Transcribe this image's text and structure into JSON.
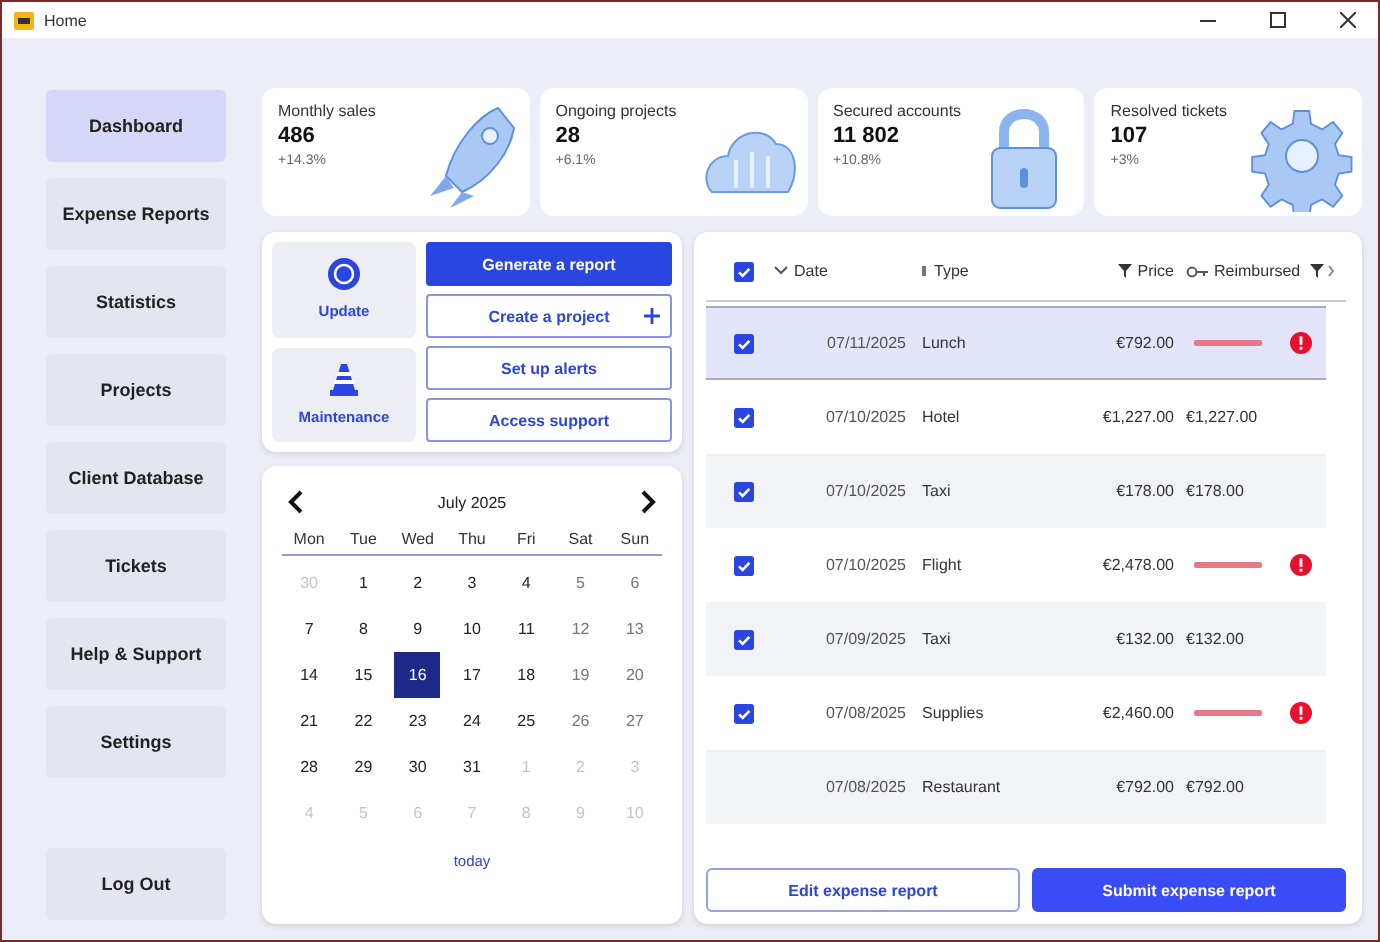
{
  "window": {
    "title": "Home"
  },
  "sidebar": {
    "items": [
      {
        "label": "Dashboard",
        "selected": true
      },
      {
        "label": "Expense Reports",
        "selected": false
      },
      {
        "label": "Statistics",
        "selected": false
      },
      {
        "label": "Projects",
        "selected": false
      },
      {
        "label": "Client Database",
        "selected": false
      },
      {
        "label": "Tickets",
        "selected": false
      },
      {
        "label": "Help & Support",
        "selected": false
      },
      {
        "label": "Settings",
        "selected": false
      }
    ],
    "logout": "Log Out"
  },
  "stats": [
    {
      "label": "Monthly sales",
      "value": "486",
      "change": "+14.3%"
    },
    {
      "label": "Ongoing projects",
      "value": "28",
      "change": "+6.1%"
    },
    {
      "label": "Secured accounts",
      "value": "11 802",
      "change": "+10.8%"
    },
    {
      "label": "Resolved tickets",
      "value": "107",
      "change": "+3%"
    }
  ],
  "quick_actions": {
    "tiles": [
      {
        "label": "Update"
      },
      {
        "label": "Maintenance"
      }
    ],
    "buttons": [
      {
        "label": "Generate a report",
        "kind": "primary"
      },
      {
        "label": "Create a project",
        "kind": "add"
      },
      {
        "label": "Set up alerts",
        "kind": "outline"
      },
      {
        "label": "Access support",
        "kind": "outline"
      }
    ]
  },
  "calendar": {
    "month": "July 2025",
    "weekdays": [
      "Mon",
      "Tue",
      "Wed",
      "Thu",
      "Fri",
      "Sat",
      "Sun"
    ],
    "days": [
      {
        "label": "30",
        "muted": true,
        "selected": false
      },
      {
        "label": "1",
        "muted": false,
        "selected": false
      },
      {
        "label": "2",
        "muted": false,
        "selected": false
      },
      {
        "label": "3",
        "muted": false,
        "selected": false
      },
      {
        "label": "4",
        "muted": false,
        "selected": false
      },
      {
        "label": "5",
        "muted": false,
        "selected": false
      },
      {
        "label": "6",
        "muted": false,
        "selected": false
      },
      {
        "label": "7",
        "muted": false,
        "selected": false
      },
      {
        "label": "8",
        "muted": false,
        "selected": false
      },
      {
        "label": "9",
        "muted": false,
        "selected": false
      },
      {
        "label": "10",
        "muted": false,
        "selected": false
      },
      {
        "label": "11",
        "muted": false,
        "selected": false
      },
      {
        "label": "12",
        "muted": false,
        "selected": false
      },
      {
        "label": "13",
        "muted": false,
        "selected": false
      },
      {
        "label": "14",
        "muted": false,
        "selected": false
      },
      {
        "label": "15",
        "muted": false,
        "selected": false
      },
      {
        "label": "16",
        "muted": false,
        "selected": true
      },
      {
        "label": "17",
        "muted": false,
        "selected": false
      },
      {
        "label": "18",
        "muted": false,
        "selected": false
      },
      {
        "label": "19",
        "muted": false,
        "selected": false
      },
      {
        "label": "20",
        "muted": false,
        "selected": false
      },
      {
        "label": "21",
        "muted": false,
        "selected": false
      },
      {
        "label": "22",
        "muted": false,
        "selected": false
      },
      {
        "label": "23",
        "muted": false,
        "selected": false
      },
      {
        "label": "24",
        "muted": false,
        "selected": false
      },
      {
        "label": "25",
        "muted": false,
        "selected": false
      },
      {
        "label": "26",
        "muted": false,
        "selected": false
      },
      {
        "label": "27",
        "muted": false,
        "selected": false
      },
      {
        "label": "28",
        "muted": false,
        "selected": false
      },
      {
        "label": "29",
        "muted": false,
        "selected": false
      },
      {
        "label": "30",
        "muted": false,
        "selected": false
      },
      {
        "label": "31",
        "muted": false,
        "selected": false
      },
      {
        "label": "1",
        "muted": true,
        "selected": false
      },
      {
        "label": "2",
        "muted": true,
        "selected": false
      },
      {
        "label": "3",
        "muted": true,
        "selected": false
      },
      {
        "label": "4",
        "muted": true,
        "selected": false
      },
      {
        "label": "5",
        "muted": true,
        "selected": false
      },
      {
        "label": "6",
        "muted": true,
        "selected": false
      },
      {
        "label": "7",
        "muted": true,
        "selected": false
      },
      {
        "label": "8",
        "muted": true,
        "selected": false
      },
      {
        "label": "9",
        "muted": true,
        "selected": false
      },
      {
        "label": "10",
        "muted": true,
        "selected": false
      }
    ],
    "today": "today"
  },
  "table": {
    "all_checked": true,
    "columns": [
      {
        "label": "Date"
      },
      {
        "label": "Type"
      },
      {
        "label": "Price"
      },
      {
        "label": "Reimbursed"
      }
    ],
    "rows": [
      {
        "checked": true,
        "selected": true,
        "date": "07/11/2025",
        "type": "Lunch",
        "price": "€792.00",
        "mismatch": true
      },
      {
        "checked": true,
        "selected": false,
        "date": "07/10/2025",
        "type": "Hotel",
        "price": "€1,227.00",
        "reimbursed": "€1,227.00",
        "mismatch": false
      },
      {
        "checked": true,
        "selected": false,
        "date": "07/10/2025",
        "type": "Taxi",
        "price": "€178.00",
        "reimbursed": "€178.00",
        "mismatch": false
      },
      {
        "checked": true,
        "selected": false,
        "date": "07/10/2025",
        "type": "Flight",
        "price": "€2,478.00",
        "mismatch": true
      },
      {
        "checked": true,
        "selected": false,
        "date": "07/09/2025",
        "type": "Taxi",
        "price": "€132.00",
        "reimbursed": "€132.00",
        "mismatch": false
      },
      {
        "checked": true,
        "selected": false,
        "date": "07/08/2025",
        "type": "Supplies",
        "price": "€2,460.00",
        "mismatch": true
      },
      {
        "checked": false,
        "selected": false,
        "date": "07/08/2025",
        "type": "Restaurant",
        "price": "€792.00",
        "reimbursed": "€792.00",
        "mismatch": false
      }
    ],
    "buttons": [
      {
        "label": "Edit expense report",
        "kind": "outline"
      },
      {
        "label": "Submit expense report",
        "kind": "primary"
      }
    ]
  }
}
